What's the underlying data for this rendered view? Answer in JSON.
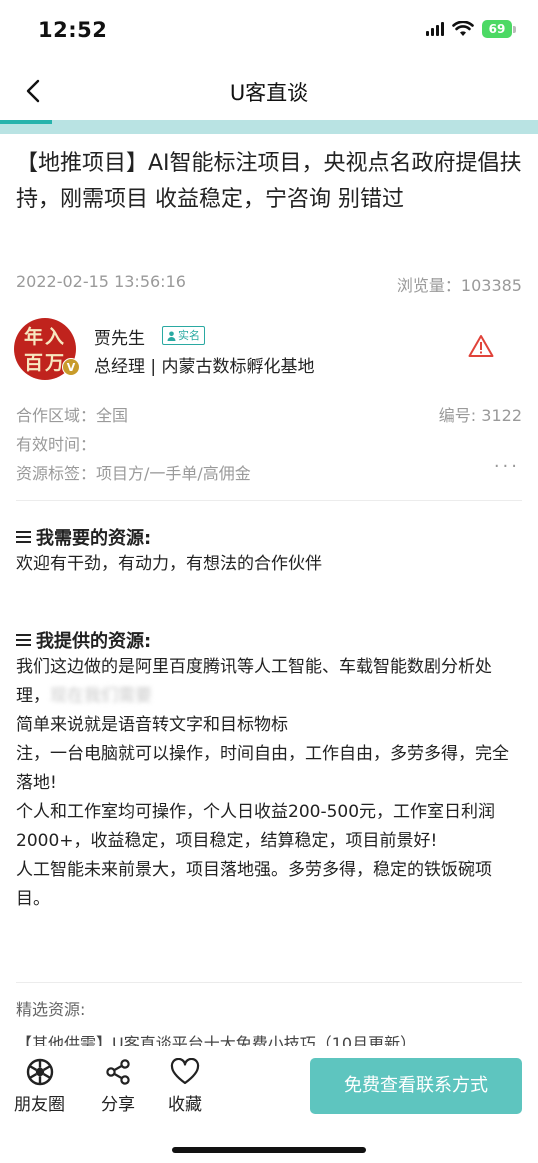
{
  "status_bar": {
    "time": "12:52",
    "battery": "69"
  },
  "nav": {
    "title": "U客直谈"
  },
  "post": {
    "title": "【地推项目】AI智能标注项目，央视点名政府提倡扶持，刚需项目 收益稳定，宁咨询 别错过",
    "date": "2022-02-15 13:56:16",
    "views": "浏览量：103385"
  },
  "author": {
    "avatar_text_line1": "年入",
    "avatar_text_line2": "百万",
    "avatar_badge": "V",
    "name": "贾先生",
    "verified_label": "实名",
    "title": "总经理 | 内蒙古数标孵化基地"
  },
  "info": {
    "region": "合作区域：全国",
    "number": "编号: 3122",
    "valid_time": "有效时间：",
    "tags": "资源标签：项目方/一手单/高佣金",
    "more": "···"
  },
  "needs": {
    "heading": "我需要的资源:",
    "text": "欢迎有干劲，有动力，有想法的合作伙伴"
  },
  "offers": {
    "heading": "我提供的资源:",
    "line1": "我们这边做的是阿里百度腾讯等人工智能、车载智能数剧分析处理，",
    "line1_blurred": "现在我们需要",
    "text_rest": "简单来说就是语音转文字和目标物标\n注，一台电脑就可以操作，时间自由，工作自由，多劳多得，完全落地!\n个人和工作室均可操作，个人日收益200-500元，工作室日利润2000+，收益稳定，项目稳定，结算稳定，项目前景好!\n人工智能未来前景大，项目落地强。多劳多得，稳定的铁饭碗项目。"
  },
  "featured": {
    "label": "精选资源:",
    "item": "【其他供需】U客直谈平台十大免费小技巧（10月更新）"
  },
  "bottom_bar": {
    "moments": "朋友圈",
    "share": "分享",
    "favorite": "收藏",
    "cta": "免费查看联系方式"
  },
  "colors": {
    "accent": "#27b3ac",
    "cta": "#5ec5bf",
    "strip": "#b9e3e3",
    "warning": "#e0433a"
  }
}
